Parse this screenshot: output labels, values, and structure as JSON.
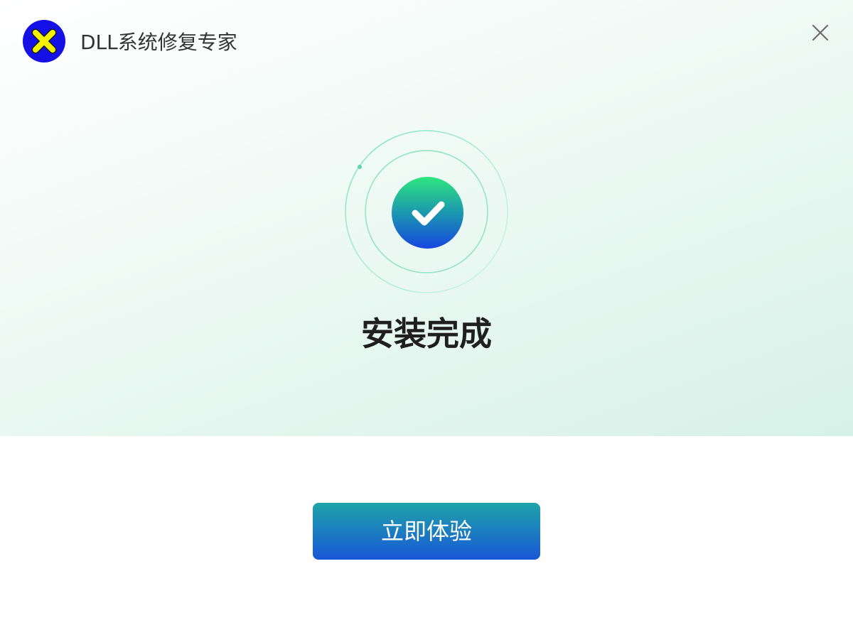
{
  "app": {
    "title": "DLL系统修复专家",
    "logo_icon": "yellow-x-logo-icon"
  },
  "header": {
    "close_icon": "close-icon"
  },
  "status": {
    "icon": "check-circle-icon",
    "title": "安装完成"
  },
  "actions": {
    "primary_label": "立即体验"
  },
  "colors": {
    "logo_bg": "#1410e6",
    "logo_mark": "#f5f100",
    "ring": "#5fdcae",
    "check_top": "#2ee67d",
    "check_bottom": "#1746e0",
    "button_top": "#1fa3a9",
    "button_bottom": "#1858d6",
    "title_text": "#1f1f1f"
  }
}
